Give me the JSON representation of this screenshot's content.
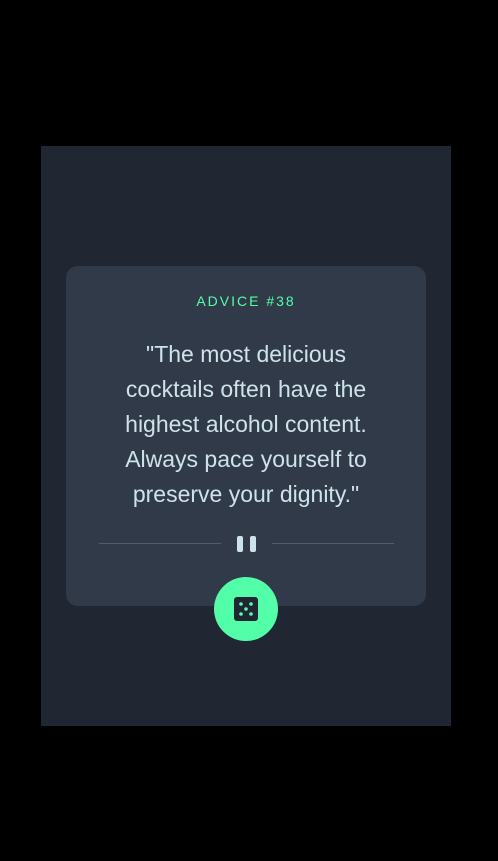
{
  "advice": {
    "id_label": "ADVICE #38",
    "quote": "\"The most delicious cocktails often have the highest alcohol content. Always pace yourself to preserve your dignity.\""
  },
  "icons": {
    "divider": "pause-icon",
    "button": "dice-icon"
  },
  "colors": {
    "page_background": "#000000",
    "frame_background": "#202733",
    "card_background": "#313a48",
    "accent": "#52ffa8",
    "quote_text": "#cee3e9",
    "divider_line": "#4f5d74"
  }
}
